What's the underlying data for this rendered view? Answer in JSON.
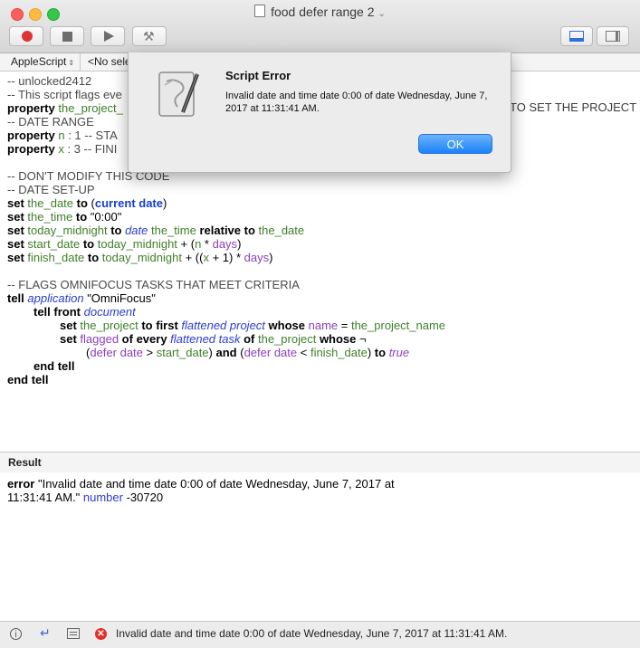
{
  "window": {
    "title": "food defer range 2",
    "doc_icon": "document-icon"
  },
  "toolbar": {
    "record_icon": "record-icon",
    "stop_icon": "stop-icon",
    "run_icon": "run-icon",
    "compile_icon": "hammer-icon",
    "view_icons": [
      "show-result-view-icon",
      "show-sidebar-icon"
    ]
  },
  "navbar": {
    "language": "AppleScript",
    "handler": "<No sele"
  },
  "editor": {
    "overflow_text": "TO SET THE PROJECT"
  },
  "dialog": {
    "title": "Script Error",
    "message": "Invalid date and time date 0:00 of date Wednesday, June 7, 2017 at 11:31:41 AM.",
    "ok_label": "OK",
    "icon": "script-editor-icon"
  },
  "result": {
    "header": "Result",
    "line1_a": "error",
    "line1_b": " \"Invalid date and time date 0:00 of date Wednesday, June 7, 2017 at",
    "line2_a": "11:31:41 AM.\" ",
    "line2_b": "number",
    "line2_c": " -30720"
  },
  "statusbar": {
    "message": "Invalid date and time date 0:00 of date Wednesday, June 7, 2017 at 11:31:41 AM."
  },
  "code": {
    "l1": "-- unlocked2412",
    "l2": "-- This script flags eve",
    "l3a": "property",
    "l3b": " the_project_",
    "l4": "-- DATE RANGE",
    "l5a": "property",
    "l5b": " n",
    "l5c": " : 1 -- STA",
    "l6a": "property",
    "l6b": " x",
    "l6c": " : 3 -- FINI",
    "l7": "-- DON'T MODIFY THIS CODE",
    "l8": "-- DATE SET-UP",
    "l9": [
      "set",
      " the_date",
      " to",
      " (",
      "current date",
      ")"
    ],
    "l10": [
      "set",
      " the_time",
      " to",
      " \"0:00\""
    ],
    "l11": [
      "set",
      " today_midnight",
      " to",
      " date",
      " the_time",
      " relative to",
      " the_date"
    ],
    "l12": [
      "set",
      " start_date",
      " to",
      " today_midnight",
      " + (",
      "n",
      " * ",
      "days",
      ")"
    ],
    "l13": [
      "set",
      " finish_date",
      " to",
      " today_midnight",
      " + ((",
      "x",
      " + 1) * ",
      "days",
      ")"
    ],
    "l14": "-- FLAGS OMNIFOCUS TASKS THAT MEET CRITERIA",
    "l15": [
      "tell",
      " application",
      " \"OmniFocus\""
    ],
    "l16": [
      "tell",
      " front",
      " document"
    ],
    "l17": [
      "set",
      " the_project",
      " to",
      " first",
      " flattened project",
      " whose",
      " name",
      " = ",
      "the_project_name"
    ],
    "l18": [
      "set",
      " flagged",
      " of",
      " every",
      " flattened task",
      " of",
      " the_project",
      " whose",
      " ¬"
    ],
    "l19": [
      "(",
      "defer date",
      " > ",
      "start_date",
      ") ",
      "and",
      " (",
      "defer date",
      " < ",
      "finish_date",
      ") ",
      "to",
      " true"
    ],
    "l20": "end tell",
    "l21": "end tell"
  }
}
